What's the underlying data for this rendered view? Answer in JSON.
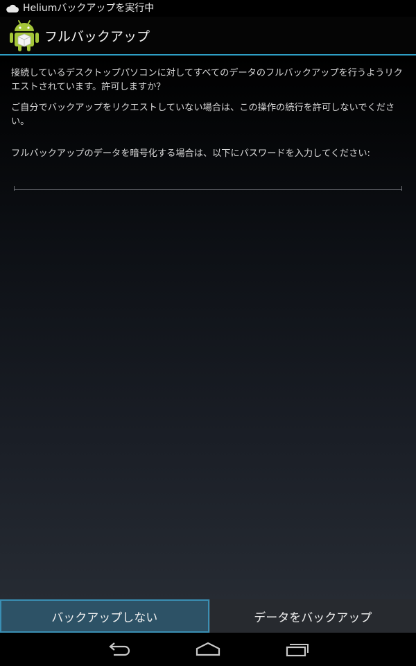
{
  "status_bar": {
    "notification_icon": "cloud-icon",
    "text": "Heliumバックアップを実行中"
  },
  "action_bar": {
    "app_icon": "android-robot-icon",
    "title": "フルバックアップ"
  },
  "content": {
    "paragraph1": "接続しているデスクトップパソコンに対してすべてのデータのフルバックアップを行うようリクエストされています。許可しますか？",
    "paragraph2": "ご自分でバックアップをリクエストしていない場合は、この操作の続行を許可しないでください。",
    "password_prompt": "フルバックアップのデータを暗号化する場合は、以下にパスワードを入力してください:",
    "password_value": ""
  },
  "buttons": {
    "deny_label": "バックアップしない",
    "allow_label": "データをバックアップ"
  },
  "nav_bar": {
    "back_icon": "back-icon",
    "home_icon": "home-icon",
    "recent_icon": "recent-apps-icon"
  },
  "colors": {
    "accent": "#2e9ec4",
    "focused_button": "#2d5266",
    "button": "#272a2f"
  }
}
